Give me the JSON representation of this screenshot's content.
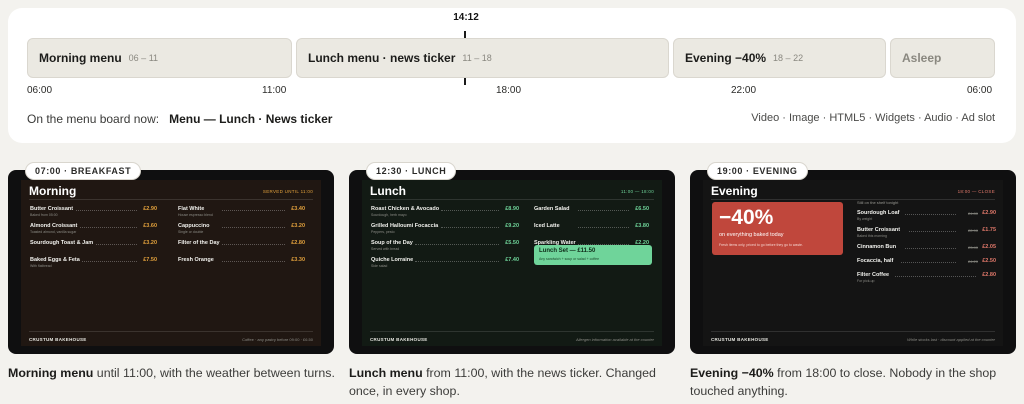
{
  "schedule": {
    "now_time": "14:12",
    "segments": [
      {
        "name": "Morning menu",
        "time": "06 – 11"
      },
      {
        "name": "Lunch menu · news ticker",
        "time": "11 – 18"
      },
      {
        "name": "Evening −40%",
        "time": "18 – 22"
      },
      {
        "name": "Asleep",
        "time": ""
      }
    ],
    "ticks": [
      "06:00",
      "11:00",
      "18:00",
      "22:00",
      "06:00"
    ],
    "on_board_label": "On the menu board now:",
    "on_board_value": "Menu — Lunch · News ticker",
    "content_types": "Video · Image · HTML5 · Widgets · Audio · Ad slot"
  },
  "cards": [
    {
      "badge": "07:00 · BREAKFAST",
      "title": "Morning",
      "note": "SERVED UNTIL 11:00",
      "items": [
        {
          "name": "Butter Croissant",
          "desc": "Baked from 05:00",
          "price": "£2.90"
        },
        {
          "name": "Flat White",
          "desc": "House espresso blend",
          "price": "£3.40"
        },
        {
          "name": "Almond Croissant",
          "desc": "Toasted almond, vanilla sugar",
          "price": "£3.60"
        },
        {
          "name": "Cappuccino",
          "desc": "Single or double",
          "price": "£3.20"
        },
        {
          "name": "Sourdough Toast & Jam",
          "desc": "",
          "price": "£3.20"
        },
        {
          "name": "Filter of the Day",
          "desc": "",
          "price": "£2.80"
        },
        {
          "name": "Baked Eggs & Feta",
          "desc": "With flatbread",
          "price": "£7.50"
        },
        {
          "name": "Fresh Orange",
          "desc": "",
          "price": "£3.30"
        }
      ],
      "footer_logo": "CRUSTUM BAKEHOUSE",
      "footer_note": "Coffee · any pastry before 09:00 · £6.50",
      "caption_bold": "Morning menu",
      "caption_rest": " until 11:00, with the weather between turns."
    },
    {
      "badge": "12:30 · LUNCH",
      "title": "Lunch",
      "note": "11:00 — 18:00",
      "items": [
        {
          "name": "Roast Chicken & Avocado",
          "desc": "Sourdough, herb mayo",
          "price": "£8.90"
        },
        {
          "name": "Garden Salad",
          "desc": "",
          "price": "£6.50"
        },
        {
          "name": "Grilled Halloumi Focaccia",
          "desc": "Peppers, pesto",
          "price": "£9.20"
        },
        {
          "name": "Iced Latte",
          "desc": "",
          "price": "£3.80"
        },
        {
          "name": "Soup of the Day",
          "desc": "Served with bread",
          "price": "£5.50"
        },
        {
          "name": "Sparkling Water",
          "desc": "",
          "price": "£2.20"
        },
        {
          "name": "Quiche Lorraine",
          "desc": "Side salad",
          "price": "£7.40"
        }
      ],
      "set": {
        "title": "Lunch Set — £11.50",
        "desc": "Any sandwich + soup or salad + coffee"
      },
      "footer_logo": "CRUSTUM BAKEHOUSE",
      "footer_note": "Allergen information available at the counter",
      "caption_bold": "Lunch menu",
      "caption_rest": " from 11:00, with the news ticker. Changed once, in every shop."
    },
    {
      "badge": "19:00 · EVENING",
      "title": "Evening",
      "note": "18:00 — CLOSE",
      "promo": {
        "big": "−40%",
        "sub": "on everything baked today",
        "small": "Fresh items only, priced to go before they go to waste."
      },
      "intro": "Still on the shelf tonight",
      "items": [
        {
          "name": "Sourdough Loaf",
          "desc": "By weight",
          "was": "£4.80",
          "price": "£2.90"
        },
        {
          "name": "Butter Croissant",
          "desc": "Baked this morning",
          "was": "£2.90",
          "price": "£1.75"
        },
        {
          "name": "Cinnamon Bun",
          "desc": "",
          "was": "£3.40",
          "price": "£2.05"
        },
        {
          "name": "Focaccia, half",
          "desc": "",
          "was": "£4.20",
          "price": "£2.50"
        },
        {
          "name": "Filter Coffee",
          "desc": "For pick-up",
          "was": "",
          "price": "£2.80"
        }
      ],
      "footer_logo": "CRUSTUM BAKEHOUSE",
      "footer_note": "While stocks last · discount applied at the counter",
      "caption_bold": "Evening −40%",
      "caption_rest": " from 18:00 to close. Nobody in the shop touched anything."
    }
  ],
  "colors": {
    "morning_bg": "#201712",
    "morning_accent": "#e2a13c",
    "lunch_bg": "#121a14",
    "lunch_accent": "#6fd49a",
    "evening_bg": "#141414",
    "evening_accent": "#e0786a",
    "promo_red": "#c0473c"
  }
}
